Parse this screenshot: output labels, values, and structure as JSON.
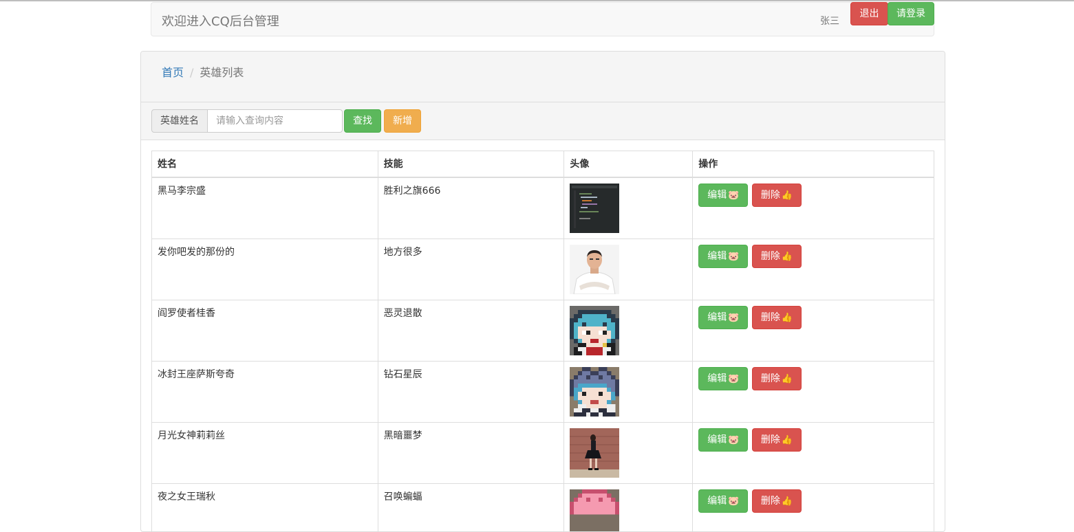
{
  "navbar": {
    "brand": "欢迎进入CQ后台管理",
    "user": "张三",
    "logout_label": "退出",
    "login_label": "请登录"
  },
  "breadcrumb": {
    "home": "首页",
    "separator": "/",
    "current": "英雄列表"
  },
  "search": {
    "addon_label": "英雄姓名",
    "placeholder": "请输入查询内容",
    "find_label": "查找",
    "add_label": "新增"
  },
  "table": {
    "headers": [
      "姓名",
      "技能",
      "头像",
      "操作"
    ],
    "edit_label": "编辑",
    "edit_emoji": "🐷",
    "delete_label": "删除",
    "delete_emoji": "👍",
    "rows": [
      {
        "name": "黑马李宗盛",
        "skill": "胜利之旗666",
        "avatar": "code-screenshot-avatar"
      },
      {
        "name": "发你吧发的那份的",
        "skill": "地方很多",
        "avatar": "man-photo-avatar"
      },
      {
        "name": "阎罗使者桂香",
        "skill": "恶灵退散",
        "avatar": "pixel-girl-blue-hair-avatar"
      },
      {
        "name": "冰封王座萨斯夸奇",
        "skill": "钻石星辰",
        "avatar": "pixel-boy-helmet-avatar"
      },
      {
        "name": "月光女神莉莉丝",
        "skill": "黑暗噩梦",
        "avatar": "woman-photo-avatar"
      },
      {
        "name": "夜之女王瑞秋",
        "skill": "召唤蝙蝠",
        "avatar": "pixel-pink-hair-avatar"
      }
    ]
  },
  "colors": {
    "danger": "#d9534f",
    "success": "#5cb85c",
    "warning": "#f0ad4e",
    "link": "#337ab7"
  }
}
